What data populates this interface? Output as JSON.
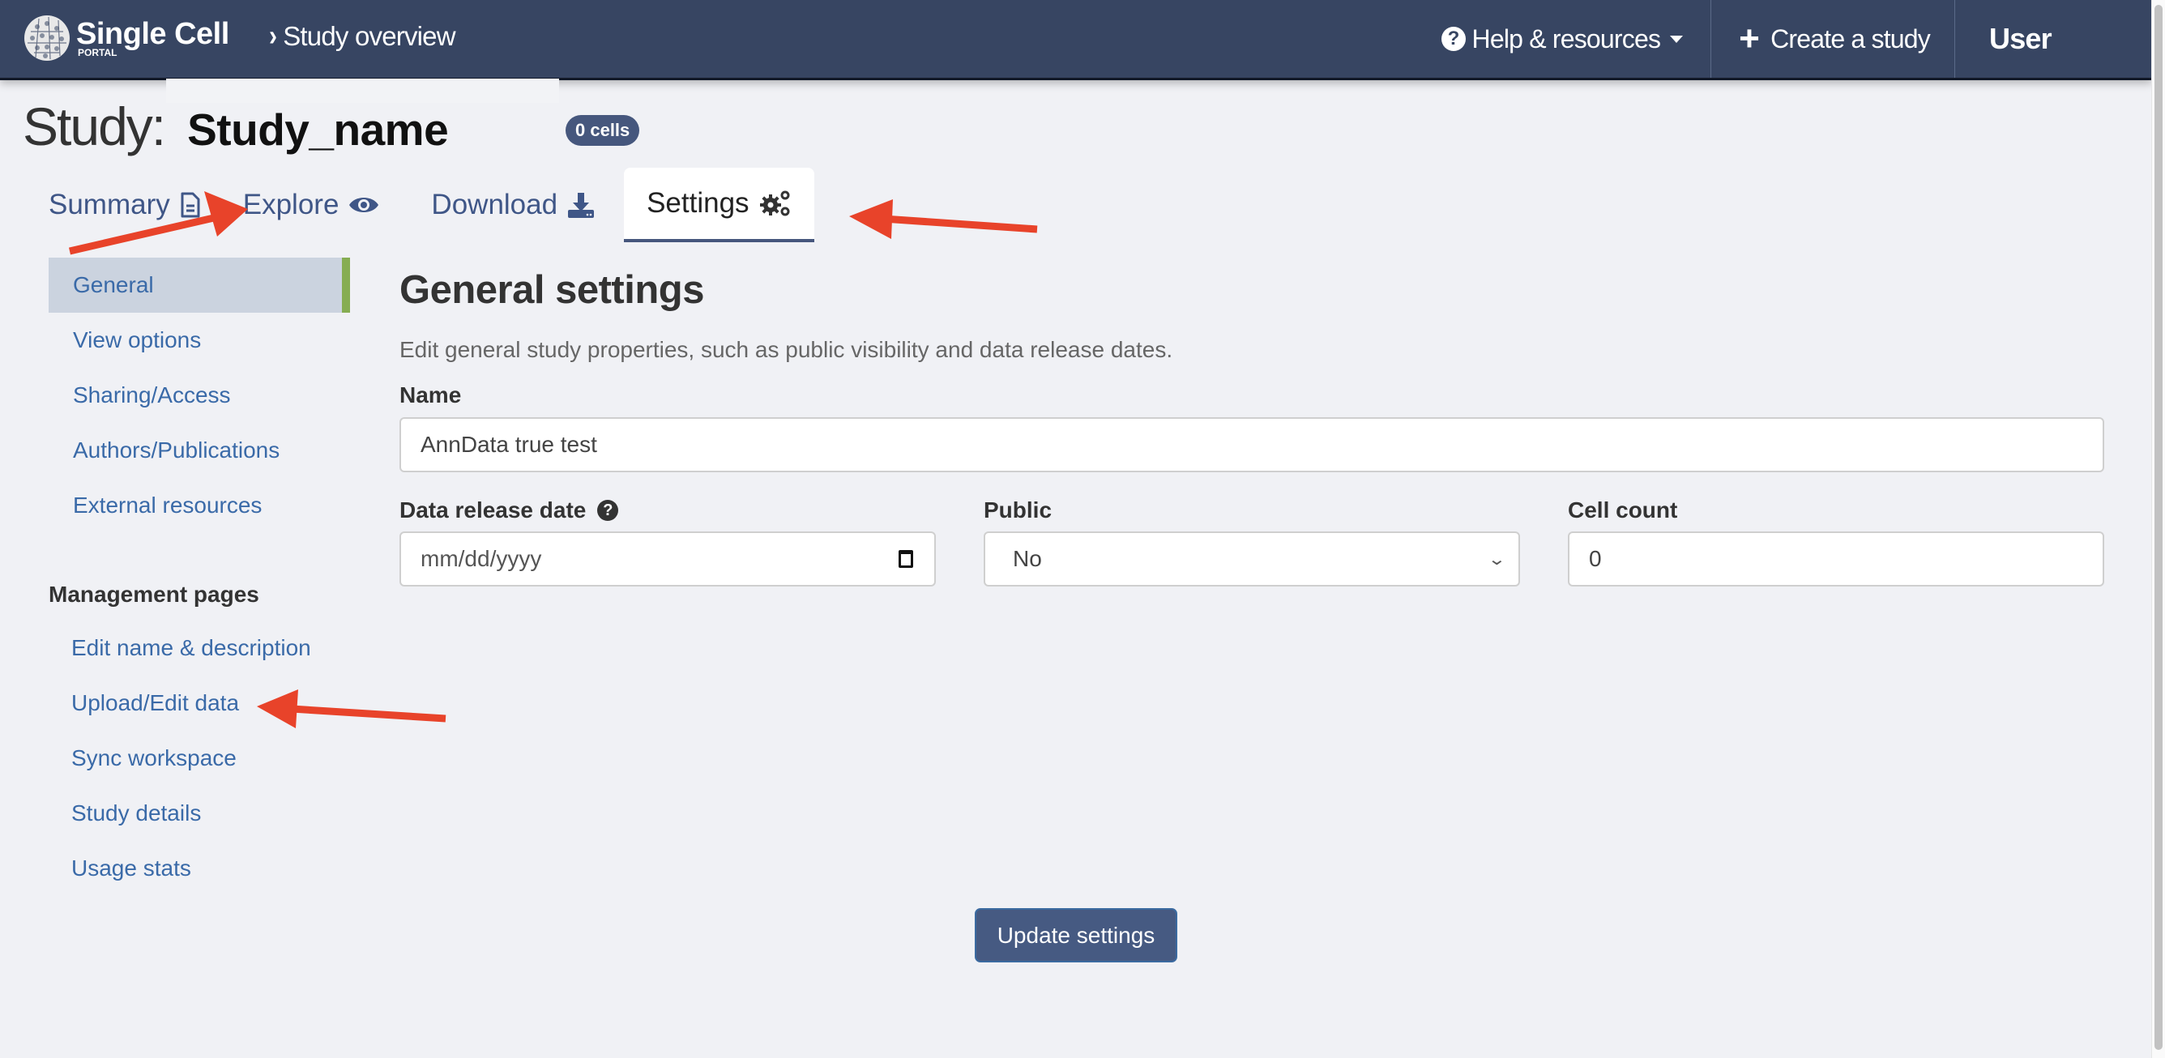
{
  "header": {
    "logo_title": "Single Cell",
    "logo_subtitle": "PORTAL",
    "breadcrumb": "Study overview",
    "help_label": "Help & resources",
    "create_label": "Create a study",
    "user_label": "User",
    "colors": {
      "navbar": "#374562",
      "accent": "#46577d"
    }
  },
  "study": {
    "label": "Study:",
    "name": "Study_name",
    "cells_badge": "0 cells"
  },
  "tabs": [
    {
      "label": "Summary",
      "icon": "file-icon",
      "active": false
    },
    {
      "label": "Explore",
      "icon": "eye-icon",
      "active": false
    },
    {
      "label": "Download",
      "icon": "download-icon",
      "active": false
    },
    {
      "label": "Settings",
      "icon": "gears-icon",
      "active": true
    }
  ],
  "sidebar": {
    "settings_items": [
      {
        "label": "General",
        "active": true
      },
      {
        "label": "View options"
      },
      {
        "label": "Sharing/Access"
      },
      {
        "label": "Authors/Publications"
      },
      {
        "label": "External resources"
      }
    ],
    "management_title": "Management pages",
    "management_items": [
      {
        "label": "Edit name & description"
      },
      {
        "label": "Upload/Edit data"
      },
      {
        "label": "Sync workspace"
      },
      {
        "label": "Study details"
      },
      {
        "label": "Usage stats"
      }
    ]
  },
  "form": {
    "title": "General settings",
    "description": "Edit general study properties, such as public visibility and data release dates.",
    "name_label": "Name",
    "name_value": "AnnData true test",
    "release_label": "Data release date",
    "release_placeholder": "mm/dd/yyyy",
    "public_label": "Public",
    "public_value": "No",
    "cell_count_label": "Cell count",
    "cell_count_value": "0",
    "submit_label": "Update settings"
  },
  "annotations": {
    "arrow_color": "#e8432a",
    "targets": [
      "Explore tab",
      "Settings tab",
      "Upload/Edit data"
    ]
  }
}
